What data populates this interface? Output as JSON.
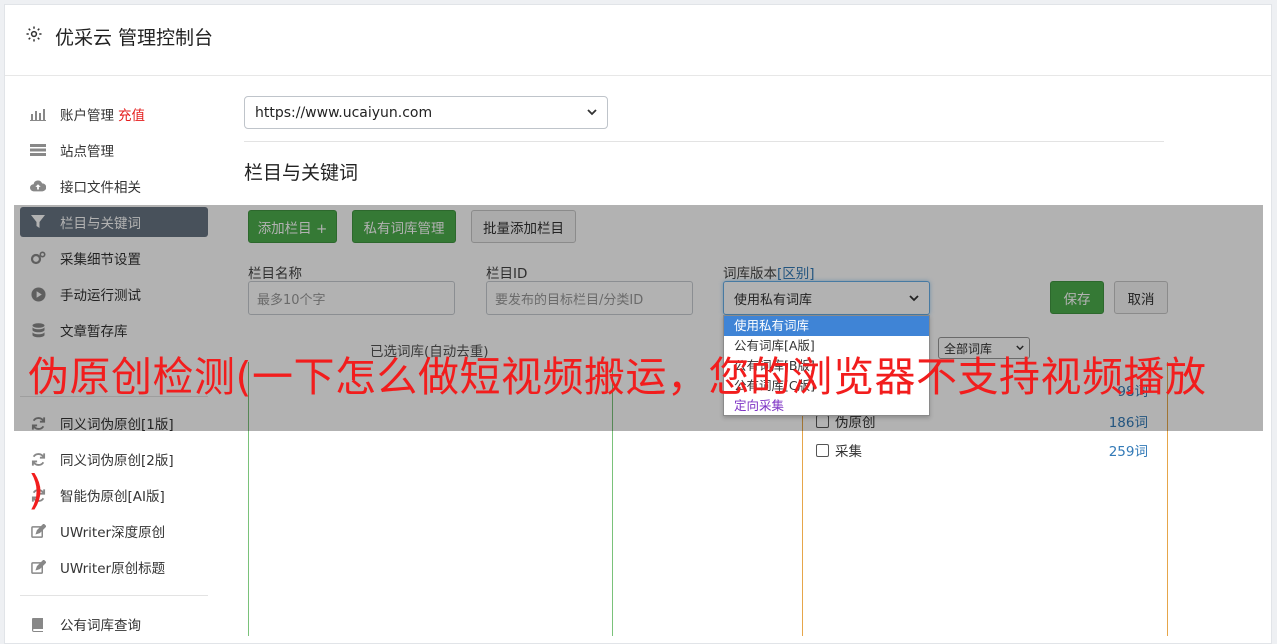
{
  "header": {
    "title": "优采云 管理控制台",
    "icon": "gear-icon"
  },
  "sidebar": {
    "items": [
      {
        "label": "账户管理",
        "extra": "充值",
        "icon": "bar-chart-icon"
      },
      {
        "label": "站点管理",
        "icon": "server-icon"
      },
      {
        "label": "接口文件相关",
        "icon": "cloud-upload-icon"
      },
      {
        "label": "栏目与关键词",
        "icon": "filter-icon"
      },
      {
        "label": "采集细节设置",
        "icon": "cogs-icon"
      },
      {
        "label": "手动运行测试",
        "icon": "play-circle-icon"
      },
      {
        "label": "文章暂存库",
        "icon": "database-icon"
      },
      {
        "label": "同义词伪原创[1版]",
        "icon": "refresh-icon"
      },
      {
        "label": "同义词伪原创[2版]",
        "icon": "refresh-icon"
      },
      {
        "label": "智能伪原创[AI版]",
        "icon": "refresh-icon"
      },
      {
        "label": "UWriter深度原创",
        "icon": "edit-icon"
      },
      {
        "label": "UWriter原创标题",
        "icon": "edit-icon"
      },
      {
        "label": "公有词库查询",
        "icon": "book-icon"
      }
    ]
  },
  "main": {
    "site_select": "https://www.ucaiyun.com",
    "section_title": "栏目与关键词",
    "buttons": {
      "add_column": "添加栏目 +",
      "private_dict": "私有词库管理",
      "batch_add": "批量添加栏目",
      "save": "保存",
      "cancel": "取消"
    },
    "form": {
      "name_label": "栏目名称",
      "name_placeholder": "最多10个字",
      "id_label": "栏目ID",
      "id_placeholder": "要发布的目标栏目/分类ID",
      "version_label": "词库版本",
      "version_link": "[区别]",
      "version_value": "使用私有词库"
    },
    "dropdown_options": [
      "使用私有词库",
      "公有词库[A版]",
      "公有词库[B版]",
      "公有词库[C版]",
      "定向采集"
    ],
    "selected_dict_label": "已选词库(自动去重)",
    "filter_select": "全部词库",
    "dict_rows": [
      {
        "label": "伪原创",
        "count": "186词"
      },
      {
        "label": "采集",
        "count": "259词"
      }
    ],
    "partial_count": "98词"
  },
  "banner": {
    "line1": "伪原创检测(一下怎么做短视频搬运，您的浏览器不支持视频播放",
    "line2": ")"
  },
  "colors": {
    "accent_green": "#4cae4c",
    "active_sidebar": "#687483",
    "link_blue": "#337ab7",
    "banner_red": "#f21d1d"
  }
}
